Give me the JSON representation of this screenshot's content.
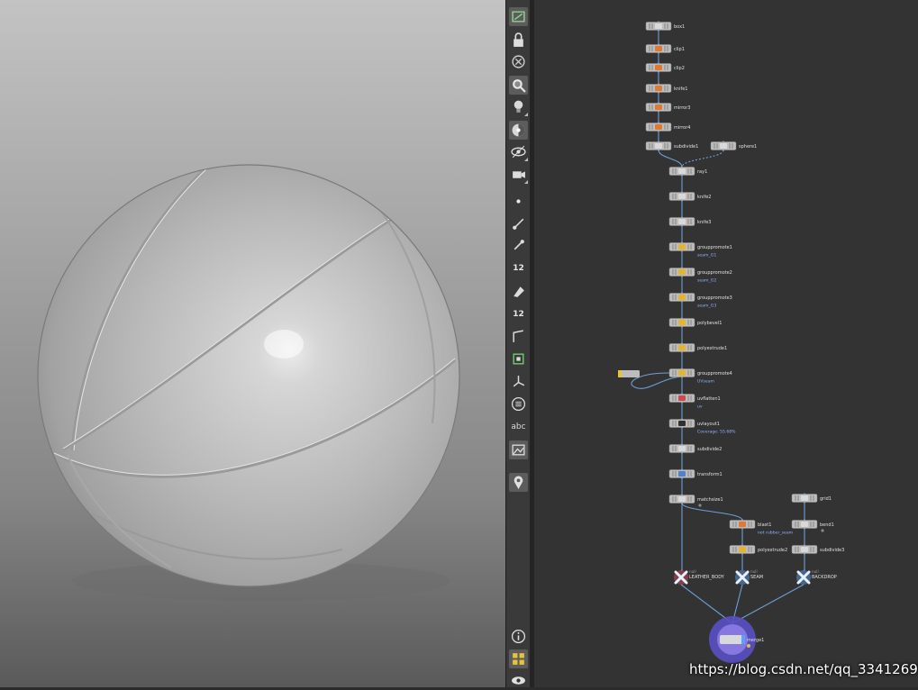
{
  "viewport": {
    "label": "3d-viewport",
    "object": "basketball-sphere",
    "colors": {
      "bg_top": "#c3c3c3",
      "bg_bottom": "#5a5a5a",
      "sphere": "#cdcdcd"
    }
  },
  "toolbar": {
    "items": [
      {
        "name": "select-display-icon",
        "active": true
      },
      {
        "name": "lock-icon",
        "active": false
      },
      {
        "name": "close-circle-icon",
        "active": false
      },
      {
        "name": "magnify-icon",
        "active": true
      },
      {
        "name": "lightbulb-icon",
        "active": false
      },
      {
        "name": "shading-icon",
        "active": true
      },
      {
        "name": "visibility-icon",
        "active": false
      },
      {
        "name": "camera-icon",
        "active": false
      },
      {
        "name": "point-icon",
        "active": false
      },
      {
        "name": "normals-icon",
        "active": false
      },
      {
        "name": "point-normals-icon",
        "active": false
      },
      {
        "name": "point-numbers-icon",
        "active": false,
        "text": "12"
      },
      {
        "name": "erase-icon",
        "active": false
      },
      {
        "name": "prim-numbers-icon",
        "active": false,
        "text": "12"
      },
      {
        "name": "edge-icon",
        "active": false
      },
      {
        "name": "snap-grid-icon",
        "active": false
      },
      {
        "name": "handle-icon",
        "active": false
      },
      {
        "name": "display-list-icon",
        "active": false
      },
      {
        "name": "text-icon",
        "active": false,
        "text": "abc"
      },
      {
        "name": "background-image-icon",
        "active": true
      },
      {
        "name": "location-pin-icon",
        "active": true
      },
      {
        "name": "info-icon",
        "active": false
      },
      {
        "name": "quad-view-icon",
        "active": true
      },
      {
        "name": "eye-icon",
        "active": false
      }
    ]
  },
  "network": {
    "nodes": [
      {
        "id": "box1",
        "label": "box1",
        "kind": "geo"
      },
      {
        "id": "clip1",
        "label": "clip1",
        "kind": "orange"
      },
      {
        "id": "clip2",
        "label": "clip2",
        "kind": "orange"
      },
      {
        "id": "knife1",
        "label": "knife1",
        "kind": "orange"
      },
      {
        "id": "mirror3",
        "label": "mirror3",
        "kind": "orange"
      },
      {
        "id": "mirror4",
        "label": "mirror4",
        "kind": "orange"
      },
      {
        "id": "subdivide1",
        "label": "subdivide1",
        "kind": "geo"
      },
      {
        "id": "sphere1",
        "label": "sphere1",
        "kind": "geo"
      },
      {
        "id": "ray1",
        "label": "ray1",
        "kind": "geo"
      },
      {
        "id": "knife2",
        "label": "knife2",
        "kind": "geo"
      },
      {
        "id": "knife3",
        "label": "knife3",
        "kind": "geo"
      },
      {
        "id": "grouppromote1",
        "label": "grouppromote1",
        "detail": "seam_G1",
        "kind": "yellow"
      },
      {
        "id": "grouppromote2",
        "label": "grouppromote2",
        "detail": "seam_G2",
        "kind": "yellow"
      },
      {
        "id": "grouppromote3",
        "label": "grouppromote3",
        "detail": "seam_G3",
        "kind": "yellow"
      },
      {
        "id": "polybevel1",
        "label": "polybevel1",
        "kind": "yellow"
      },
      {
        "id": "polyextrude1",
        "label": "polyextrude1",
        "kind": "yellow"
      },
      {
        "id": "grouppromote4",
        "label": "grouppromote4",
        "detail": "UVseam",
        "kind": "yellow"
      },
      {
        "id": "uvflatten1",
        "label": "uvflatten1",
        "detail": "uv",
        "kind": "red"
      },
      {
        "id": "uvlayout1",
        "label": "uvlayout1",
        "detail": "Coverage: 55.68%",
        "kind": "dark"
      },
      {
        "id": "subdivide2",
        "label": "subdivide2",
        "kind": "geo"
      },
      {
        "id": "transform1",
        "label": "transform1",
        "kind": "blue"
      },
      {
        "id": "matchsize1",
        "label": "matchsize1",
        "kind": "geo"
      },
      {
        "id": "blast1",
        "label": "blast1",
        "detail": "not rubber_seam",
        "kind": "orange"
      },
      {
        "id": "polyextrude2",
        "label": "polyextrude2",
        "kind": "yellow"
      },
      {
        "id": "grid1",
        "label": "grid1",
        "kind": "geo"
      },
      {
        "id": "bend1",
        "label": "bend1",
        "kind": "geo"
      },
      {
        "id": "subdivide3",
        "label": "subdivide3",
        "kind": "geo"
      }
    ],
    "nulls": [
      {
        "id": "leather",
        "header": "null",
        "label": "LEATHER_BODY",
        "color": "#c24a5a"
      },
      {
        "id": "seam",
        "header": "null",
        "label": "SEAM",
        "color": "#5a8fd0"
      },
      {
        "id": "backdrop",
        "header": "null",
        "label": "BACKDROP",
        "color": "#5a8fd0"
      }
    ],
    "merge": {
      "label": "merge1",
      "color": "#7a5ad6"
    },
    "colors": {
      "wire": "#6d9fd6",
      "node": "#bcbcbc",
      "bg": "#333333"
    }
  },
  "watermark": {
    "text": "https://blog.csdn.net/qq_33412699"
  }
}
